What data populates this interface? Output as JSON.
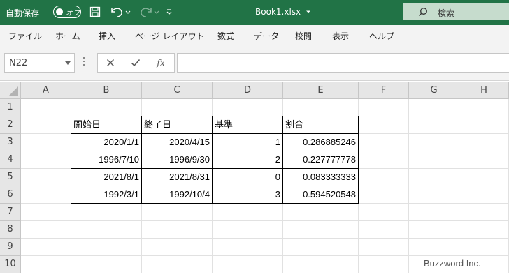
{
  "titlebar": {
    "autosave_label": "自動保存",
    "autosave_state": "オフ",
    "filename": "Book1.xlsx",
    "search_label": "検索"
  },
  "menu": [
    "ファイル",
    "ホーム",
    "挿入",
    "ページ レイアウト",
    "数式",
    "データ",
    "校閲",
    "表示",
    "ヘルプ"
  ],
  "formula_bar": {
    "name_box": "N22",
    "fx_label": "fx",
    "formula": ""
  },
  "grid": {
    "columns": [
      "A",
      "B",
      "C",
      "D",
      "E",
      "F",
      "G",
      "H"
    ],
    "rows": [
      "1",
      "2",
      "3",
      "4",
      "5",
      "6",
      "7",
      "8",
      "9",
      "10"
    ],
    "headers": [
      "開始日",
      "終了日",
      "基準",
      "割合"
    ],
    "data": [
      [
        "2020/1/1",
        "2020/4/15",
        "1",
        "0.286885246"
      ],
      [
        "1996/7/10",
        "1996/9/30",
        "2",
        "0.227777778"
      ],
      [
        "2021/8/1",
        "2021/8/31",
        "0",
        "0.083333333"
      ],
      [
        "1992/3/1",
        "1992/10/4",
        "3",
        "0.594520548"
      ]
    ]
  },
  "watermark": "Buzzword Inc.",
  "colors": {
    "titlebar": "#217346",
    "search_box": "#c6dccd",
    "ribbon": "#f3f3f3",
    "header": "#e6e6e6",
    "gridline": "#e1e1e1"
  }
}
